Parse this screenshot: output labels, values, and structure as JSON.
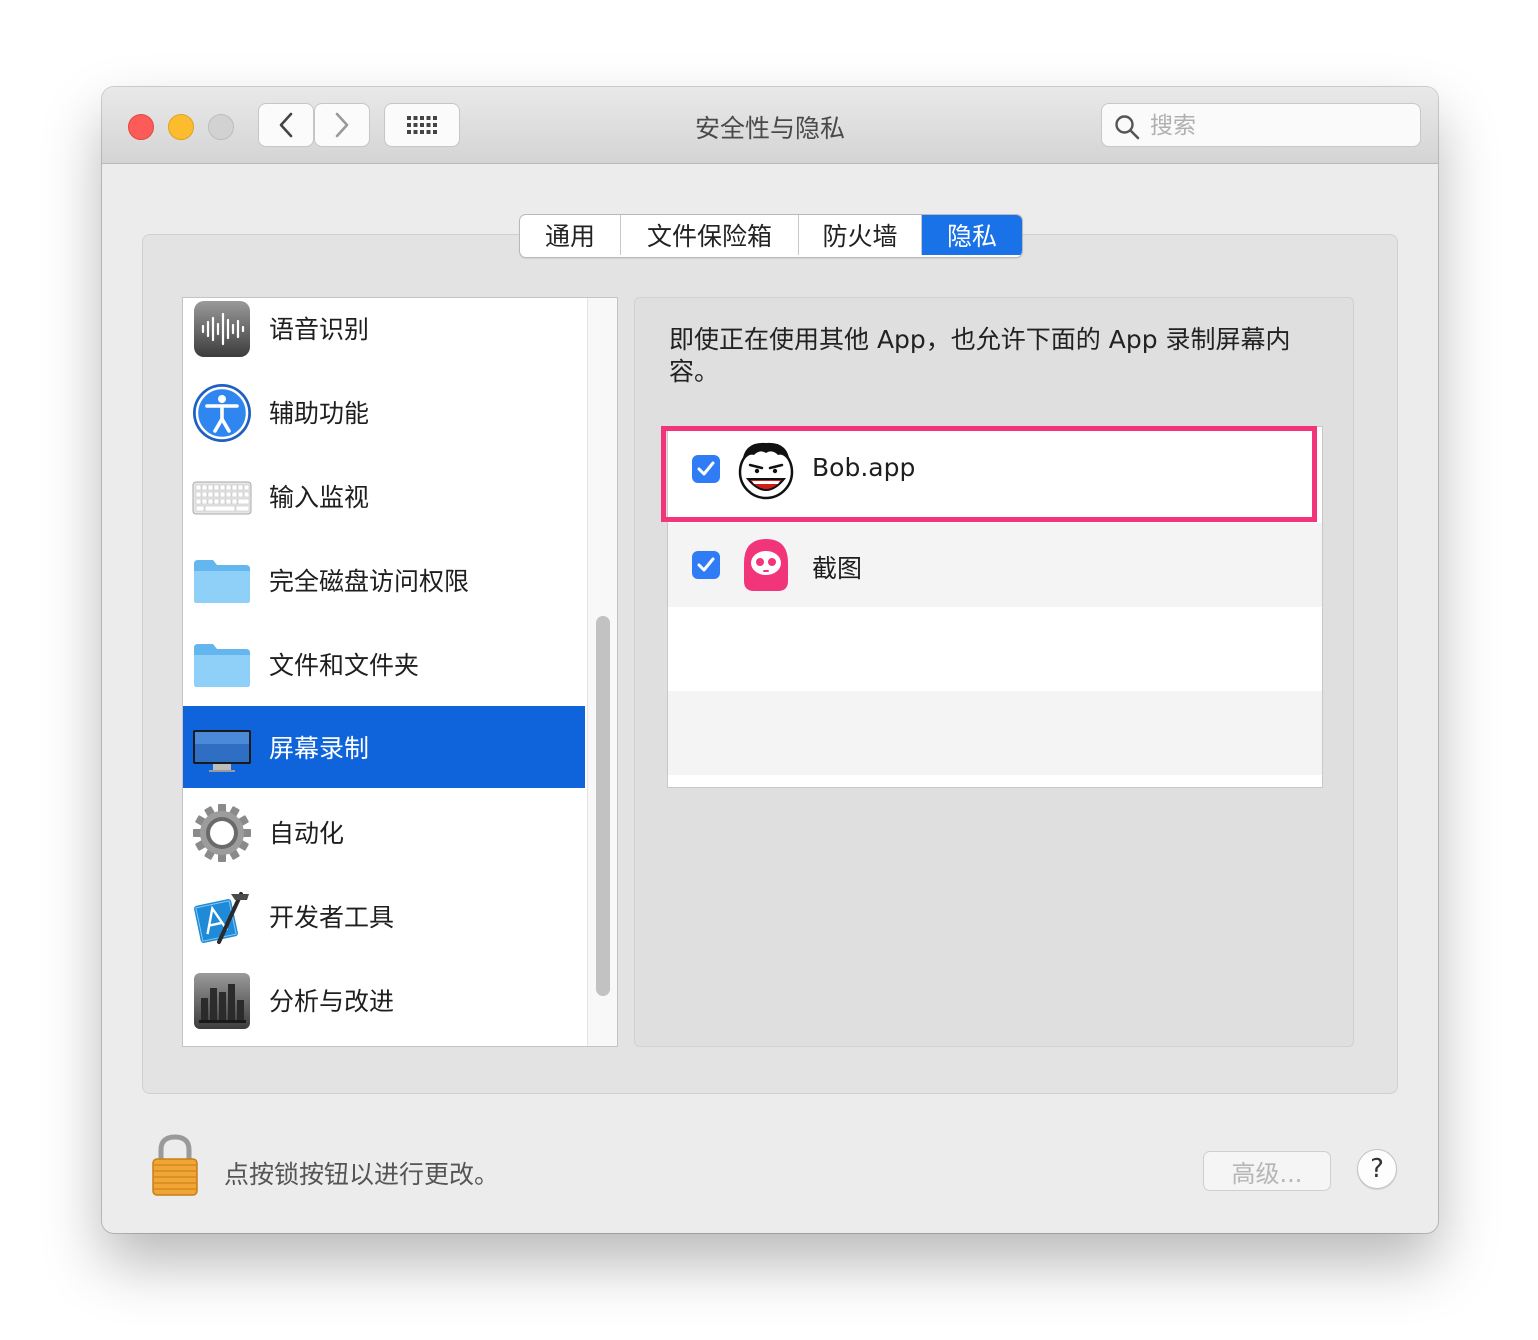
{
  "window": {
    "title": "安全性与隐私"
  },
  "search": {
    "placeholder": "搜索",
    "value": ""
  },
  "tabs": [
    {
      "label": "通用",
      "active": false
    },
    {
      "label": "文件保险箱",
      "active": false
    },
    {
      "label": "防火墙",
      "active": false
    },
    {
      "label": "隐私",
      "active": true
    }
  ],
  "sidebar": {
    "items": [
      {
        "label": "语音识别",
        "icon": "speech-recognition-icon",
        "selected": false
      },
      {
        "label": "辅助功能",
        "icon": "accessibility-icon",
        "selected": false
      },
      {
        "label": "输入监视",
        "icon": "keyboard-icon",
        "selected": false
      },
      {
        "label": "完全磁盘访问权限",
        "icon": "folder-icon",
        "selected": false
      },
      {
        "label": "文件和文件夹",
        "icon": "folder-icon",
        "selected": false
      },
      {
        "label": "屏幕录制",
        "icon": "display-icon",
        "selected": true
      },
      {
        "label": "自动化",
        "icon": "gear-icon",
        "selected": false
      },
      {
        "label": "开发者工具",
        "icon": "developer-tools-icon",
        "selected": false
      },
      {
        "label": "分析与改进",
        "icon": "bar-chart-icon",
        "selected": false
      }
    ]
  },
  "detail": {
    "description": "即使正在使用其他 App，也允许下面的 App 录制屏幕内容。",
    "apps": [
      {
        "name": "Bob.app",
        "checked": true,
        "icon": "bob-app-icon",
        "highlighted": true
      },
      {
        "name": "截图",
        "checked": true,
        "icon": "screenshot-app-icon",
        "highlighted": false
      }
    ]
  },
  "footer": {
    "lock_text": "点按锁按钮以进行更改。",
    "advanced_label": "高级...",
    "help_label": "?"
  },
  "colors": {
    "accent": "#1a72e8",
    "selection": "#0f63db",
    "highlight": "#f2357a"
  }
}
